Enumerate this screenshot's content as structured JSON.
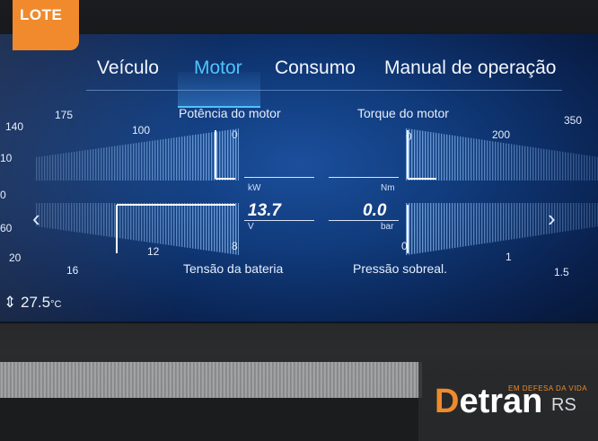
{
  "badge": {
    "text": "LOTE"
  },
  "tabs": [
    {
      "label": "Veículo"
    },
    {
      "label": "Motor"
    },
    {
      "label": "Consumo"
    },
    {
      "label": "Manual de operação"
    }
  ],
  "gauges": {
    "power_title": "Potência do motor",
    "torque_title": "Torque do motor",
    "battery_title": "Tensão da bateria",
    "boost_title": "Pressão sobreal.",
    "power_ticks": [
      "175",
      "100",
      "0"
    ],
    "torque_ticks": [
      "0",
      "200",
      "350"
    ],
    "battery_ticks": [
      "16",
      "12",
      "8"
    ],
    "boost_ticks": [
      "0",
      "1",
      "1.5"
    ],
    "left_edge_ticks": [
      "140",
      "10",
      "0",
      "60",
      "20"
    ],
    "power_value": "13.7",
    "power_unit": "kW",
    "battery_unit": "V",
    "torque_value": "0.0",
    "torque_unit": "Nm",
    "boost_unit": "bar"
  },
  "status": {
    "temperature": "27.5",
    "temperature_unit": "°C"
  },
  "nav": {
    "prev": "‹",
    "next": "›"
  },
  "watermark": {
    "tagline": "EM DEFESA DA VIDA",
    "brand_initial": "D",
    "brand_rest": "etran",
    "brand_suffix": "RS"
  },
  "colors": {
    "accent": "#4fc3ff",
    "badge": "#f08a2c",
    "screen": "#103a7a"
  }
}
